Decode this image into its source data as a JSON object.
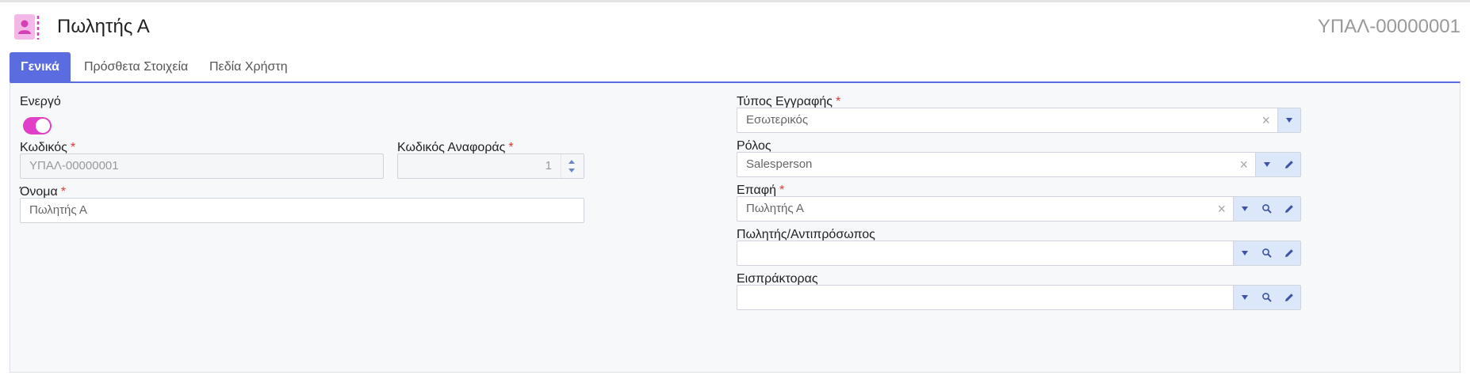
{
  "header": {
    "title": "Πωλητής Α",
    "code": "ΥΠΑΛ-00000001",
    "icon": "contact-book-icon"
  },
  "tabs": [
    {
      "label": "Γενικά",
      "active": true
    },
    {
      "label": "Πρόσθετα Στοιχεία",
      "active": false
    },
    {
      "label": "Πεδία Χρήστη",
      "active": false
    }
  ],
  "form": {
    "active": {
      "label": "Ενεργό",
      "value": true
    },
    "code": {
      "label": "Κωδικός",
      "required": "*",
      "value": "ΥΠΑΛ-00000001"
    },
    "ref_code": {
      "label": "Κωδικός Αναφοράς",
      "required": "*",
      "value": "1"
    },
    "name": {
      "label": "Όνομα",
      "required": "*",
      "value": "Πωλητής Α"
    },
    "record_type": {
      "label": "Τύπος Εγγραφής",
      "required": "*",
      "value": "Εσωτερικός"
    },
    "role": {
      "label": "Ρόλος",
      "value": "Salesperson"
    },
    "contact": {
      "label": "Επαφή",
      "required": "*",
      "value": "Πωλητής Α"
    },
    "sales_rep": {
      "label": "Πωλητής/Αντιπρόσωπος",
      "value": ""
    },
    "collector": {
      "label": "Εισπράκτορας",
      "value": ""
    }
  },
  "colors": {
    "accent": "#5b6be0",
    "toggle_on": "#e040c8",
    "required": "#e53935",
    "icon_bg": "#f4b8e8",
    "icon_fg": "#d63fb3"
  }
}
